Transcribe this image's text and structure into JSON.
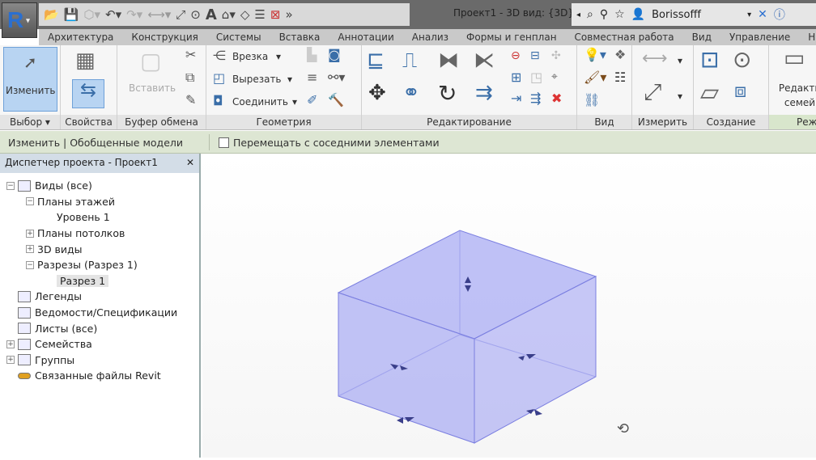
{
  "app": {
    "logo": "R",
    "title": "Проект1 - 3D вид: {3D}",
    "user": "Borissofff"
  },
  "tabs": [
    "Архитектура",
    "Конструкция",
    "Системы",
    "Вставка",
    "Аннотации",
    "Анализ",
    "Формы и генплан",
    "Совместная работа",
    "Вид",
    "Управление",
    "Над"
  ],
  "ribbon": {
    "modify_label": "Изменить",
    "paste_label": "Вставить",
    "geometry": {
      "cut_in": "Врезка",
      "cut": "Вырезать",
      "join": "Соединить"
    },
    "edit_family": "Редакти семей",
    "panels": [
      "Выбор",
      "Свойства",
      "Буфер обмена",
      "Геометрия",
      "Редактирование",
      "Вид",
      "Измерить",
      "Создание",
      "Реж"
    ]
  },
  "options_bar": {
    "context": "Изменить | Обобщенные модели",
    "checkbox_label": "Перемещать с соседними элементами",
    "checked": false
  },
  "browser": {
    "title": "Диспетчер проекта - Проект1",
    "items": [
      {
        "label": "Виды (все)",
        "level": 0,
        "toggle": "−"
      },
      {
        "label": "Планы этажей",
        "level": 1,
        "toggle": "−"
      },
      {
        "label": "Уровень 1",
        "level": 2,
        "toggle": ""
      },
      {
        "label": "Планы потолков",
        "level": 1,
        "toggle": "+"
      },
      {
        "label": "3D виды",
        "level": 1,
        "toggle": "+"
      },
      {
        "label": "Разрезы (Разрез 1)",
        "level": 1,
        "toggle": "−"
      },
      {
        "label": "Разрез 1",
        "level": 2,
        "toggle": "",
        "selected": true
      },
      {
        "label": "Легенды",
        "level": 0,
        "toggle": "",
        "icon": true
      },
      {
        "label": "Ведомости/Спецификации",
        "level": 0,
        "toggle": "",
        "icon": true
      },
      {
        "label": "Листы (все)",
        "level": 0,
        "toggle": "",
        "icon": true
      },
      {
        "label": "Семейства",
        "level": 0,
        "toggle": "+",
        "icon": true
      },
      {
        "label": "Группы",
        "level": 0,
        "toggle": "+",
        "icon": true
      },
      {
        "label": "Связанные файлы Revit",
        "level": 0,
        "toggle": "",
        "icon": true
      }
    ]
  },
  "colors": {
    "box_fill": "#9a9cf2",
    "box_edge": "#7b7fe0",
    "accent": "#b8d4f2"
  }
}
